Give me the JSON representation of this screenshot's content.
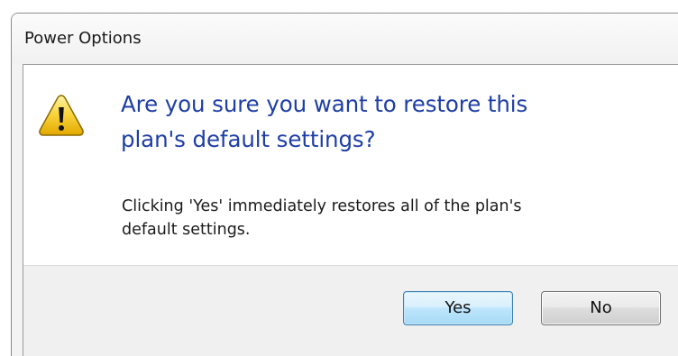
{
  "window": {
    "title": "Power Options"
  },
  "dialog": {
    "icon": "warning-icon",
    "main_instruction_lines": [
      "Are you sure you want to restore this",
      "plan's default settings?"
    ],
    "content_lines": [
      "Clicking 'Yes' immediately restores all of the plan's",
      "default settings."
    ]
  },
  "buttons": {
    "yes_label": "Yes",
    "no_label": "No"
  },
  "colors": {
    "instruction_text": "#1e3ea6",
    "icon_yellow": "#f5c518",
    "default_button_border": "#3c7fb1"
  }
}
